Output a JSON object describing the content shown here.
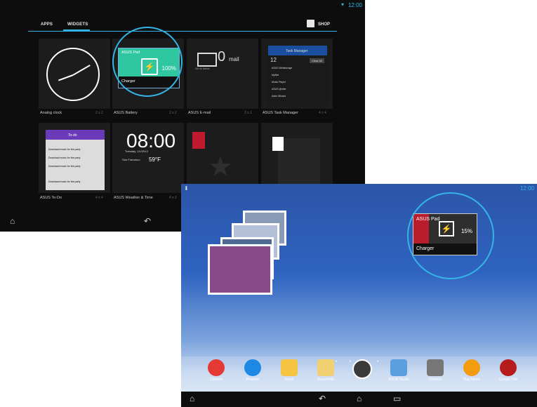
{
  "screen1": {
    "status": {
      "time": "12:00"
    },
    "tabs": [
      {
        "label": "APPS",
        "active": false
      },
      {
        "label": "WIDGETS",
        "active": true
      }
    ],
    "shop_label": "SHOP",
    "widgets": [
      {
        "name": "Analog clock",
        "size": "2 x 2"
      },
      {
        "name": "ASUS Battery",
        "size": "2 x 2",
        "card_title": "ASUS Pad",
        "pct": "100%",
        "charger": "Charger"
      },
      {
        "name": "ASUS E-mail",
        "size": "3 x 1",
        "count": "0",
        "word": "mail",
        "goto": "Go to Inbox"
      },
      {
        "name": "ASUS Task Manager",
        "size": "4 x 4",
        "title": "Task Manager",
        "count": "12",
        "clear": "Clear All",
        "rows": [
          "ASUS Webstorage",
          "MyNet",
          "Music Player",
          "ASUS @vibe",
          "Astro Wizard"
        ]
      },
      {
        "name": "ASUS To-Do",
        "size": "4 x 4",
        "title": "To-do",
        "rows": [
          "Download music for the party",
          "Download music for the party",
          "Download music for the party",
          "Download music for the party"
        ]
      },
      {
        "name": "ASUS Weather & Time",
        "size": "4 x 2",
        "time": "08:00",
        "date": "Tuesday, 1/1/2013",
        "city": "San Francisco",
        "temp": "59°F"
      },
      {
        "name": "",
        "size": ""
      },
      {
        "name": "",
        "size": ""
      }
    ]
  },
  "screen2": {
    "status": {
      "time": "12:00"
    },
    "battery": {
      "title": "ASUS Pad",
      "pct": "15%",
      "charger": "Charger"
    },
    "dock": [
      {
        "label": "Chrome",
        "color": "#e53935"
      },
      {
        "label": "Browser",
        "color": "#1e88e5"
      },
      {
        "label": "Email",
        "color": "#f5c542"
      },
      {
        "label": "SuperNote",
        "color": "#f0d070"
      },
      {
        "label": "",
        "color": "#3a3a3a"
      },
      {
        "label": "ASUS Studio",
        "color": "#5aa0e0"
      },
      {
        "label": "Camera",
        "color": "#777777"
      },
      {
        "label": "Play Music",
        "color": "#f39c12"
      },
      {
        "label": "Google Talk",
        "color": "#b71c1c"
      }
    ]
  },
  "colors": {
    "accent": "#33b5e5",
    "battery_full": "#2ec7a0",
    "battery_low": "#b91c2a"
  }
}
